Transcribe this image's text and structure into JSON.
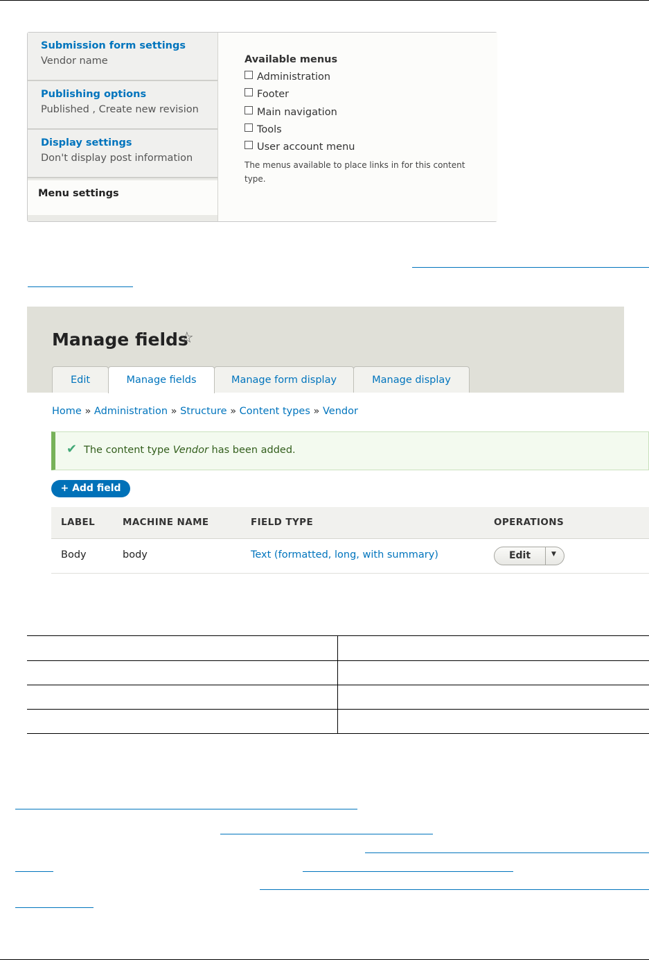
{
  "vertical_tabs": {
    "items": [
      {
        "title": "Submission form settings",
        "summary": "Vendor name"
      },
      {
        "title": "Publishing options",
        "summary": "Published , Create new revision"
      },
      {
        "title": "Display settings",
        "summary": "Don't display post information"
      }
    ],
    "selected": "Menu settings",
    "pane": {
      "title": "Available menus",
      "checkboxes": [
        "Administration",
        "Footer",
        "Main navigation",
        "Tools",
        "User account menu"
      ],
      "description": "The menus available to place links in for this content type."
    }
  },
  "manage_fields": {
    "title": "Manage fields",
    "star": "☆",
    "tabs": [
      "Edit",
      "Manage fields",
      "Manage form display",
      "Manage display"
    ],
    "active_tab": "Manage fields",
    "breadcrumb": [
      "Home",
      "Administration",
      "Structure",
      "Content types",
      "Vendor"
    ],
    "breadcrumb_sep": "»",
    "message": {
      "before": "The content type ",
      "emphasis": "Vendor",
      "after": " has been added."
    },
    "add_button": "+ Add field",
    "columns": [
      "LABEL",
      "MACHINE NAME",
      "FIELD TYPE",
      "OPERATIONS"
    ],
    "row": {
      "label": "Body",
      "machine_name": "body",
      "field_type": "Text (formatted, long, with summary)",
      "operation": "Edit"
    }
  },
  "colors": {
    "link": "#0074bd",
    "success": "#77b259",
    "primary_button": "#0071b8"
  }
}
